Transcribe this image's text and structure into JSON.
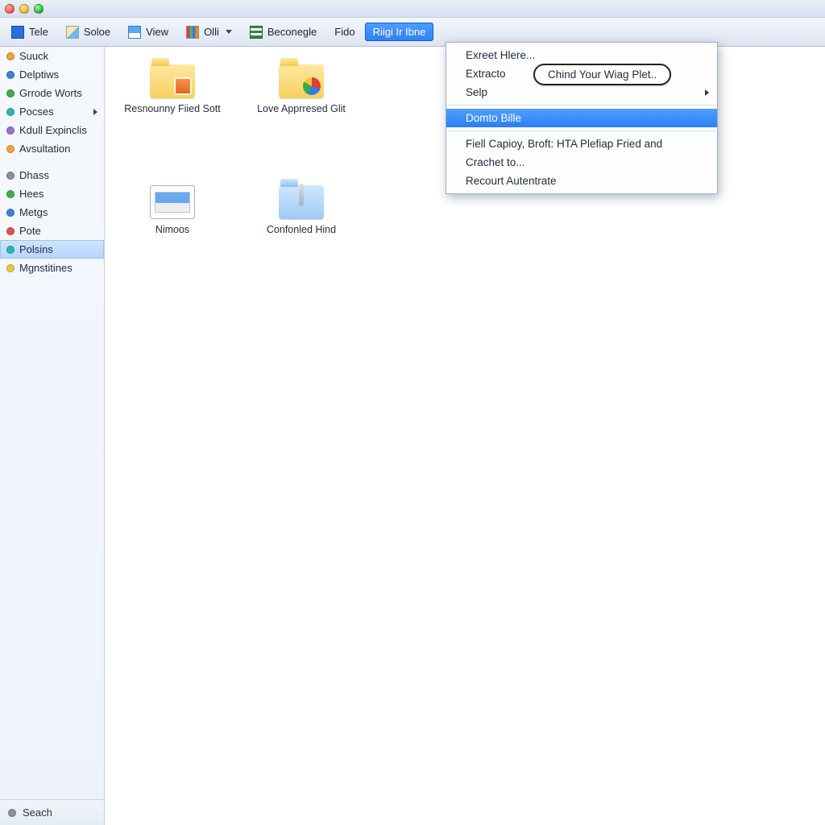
{
  "toolbar": {
    "items": [
      {
        "label": "Tele",
        "icon": "blue-sq"
      },
      {
        "label": "Soloe",
        "icon": "pencil"
      },
      {
        "label": "View",
        "icon": "cal"
      },
      {
        "label": "Olli",
        "icon": "bars",
        "caret": true
      },
      {
        "label": "Beconegle",
        "icon": "grid"
      },
      {
        "label": "Fido",
        "icon": "",
        "plain": true
      },
      {
        "label": "Riigi Ir Ibne",
        "icon": "",
        "open": true
      }
    ]
  },
  "sidebar": {
    "items": [
      {
        "label": "Suuck",
        "color": "c-orange"
      },
      {
        "label": "Delptiws",
        "color": "c-blue"
      },
      {
        "label": "Grrode Worts",
        "color": "c-green"
      },
      {
        "label": "Pocses",
        "color": "c-teal",
        "submenu": true
      },
      {
        "label": "Kdull Expinclis",
        "color": "c-purple"
      },
      {
        "label": "Avsultation",
        "color": "c-orange",
        "gap_after": true
      },
      {
        "label": "Dhass",
        "color": "c-gray"
      },
      {
        "label": "Hees",
        "color": "c-green"
      },
      {
        "label": "Metgs",
        "color": "c-blue"
      },
      {
        "label": "Pote",
        "color": "c-red"
      },
      {
        "label": "Polsins",
        "color": "c-teal",
        "selected": true
      },
      {
        "label": "Mgnstitines",
        "color": "c-yellow"
      }
    ],
    "bottom_label": "Seach"
  },
  "content": {
    "items": [
      {
        "label": "Resnounny Fiied Sott",
        "type": "folder",
        "emblem": "app"
      },
      {
        "label": "Love Apprresed Glit",
        "type": "folder",
        "emblem": "pie"
      },
      {
        "label": "Nimoos",
        "type": "thumb"
      },
      {
        "label": "Confonled Hind",
        "type": "folder-blue",
        "emblem": "pin"
      }
    ]
  },
  "context_menu": {
    "bubble": "Chind Your Wiag Plet..",
    "rows": [
      {
        "label": "Exreet Hlere...",
        "type": "item"
      },
      {
        "label": "Extracto",
        "type": "item"
      },
      {
        "label": "Selp",
        "type": "item",
        "submenu": true
      },
      {
        "type": "sep"
      },
      {
        "label": "Domto Bille",
        "type": "item",
        "highlight": true
      },
      {
        "type": "sep"
      },
      {
        "label": "Fiell Capioy, Broft: HTA Plefiap Fried and",
        "type": "item"
      },
      {
        "label": "Crachet to...",
        "type": "item"
      },
      {
        "label": "Recourt Autentrate",
        "type": "item"
      }
    ]
  }
}
